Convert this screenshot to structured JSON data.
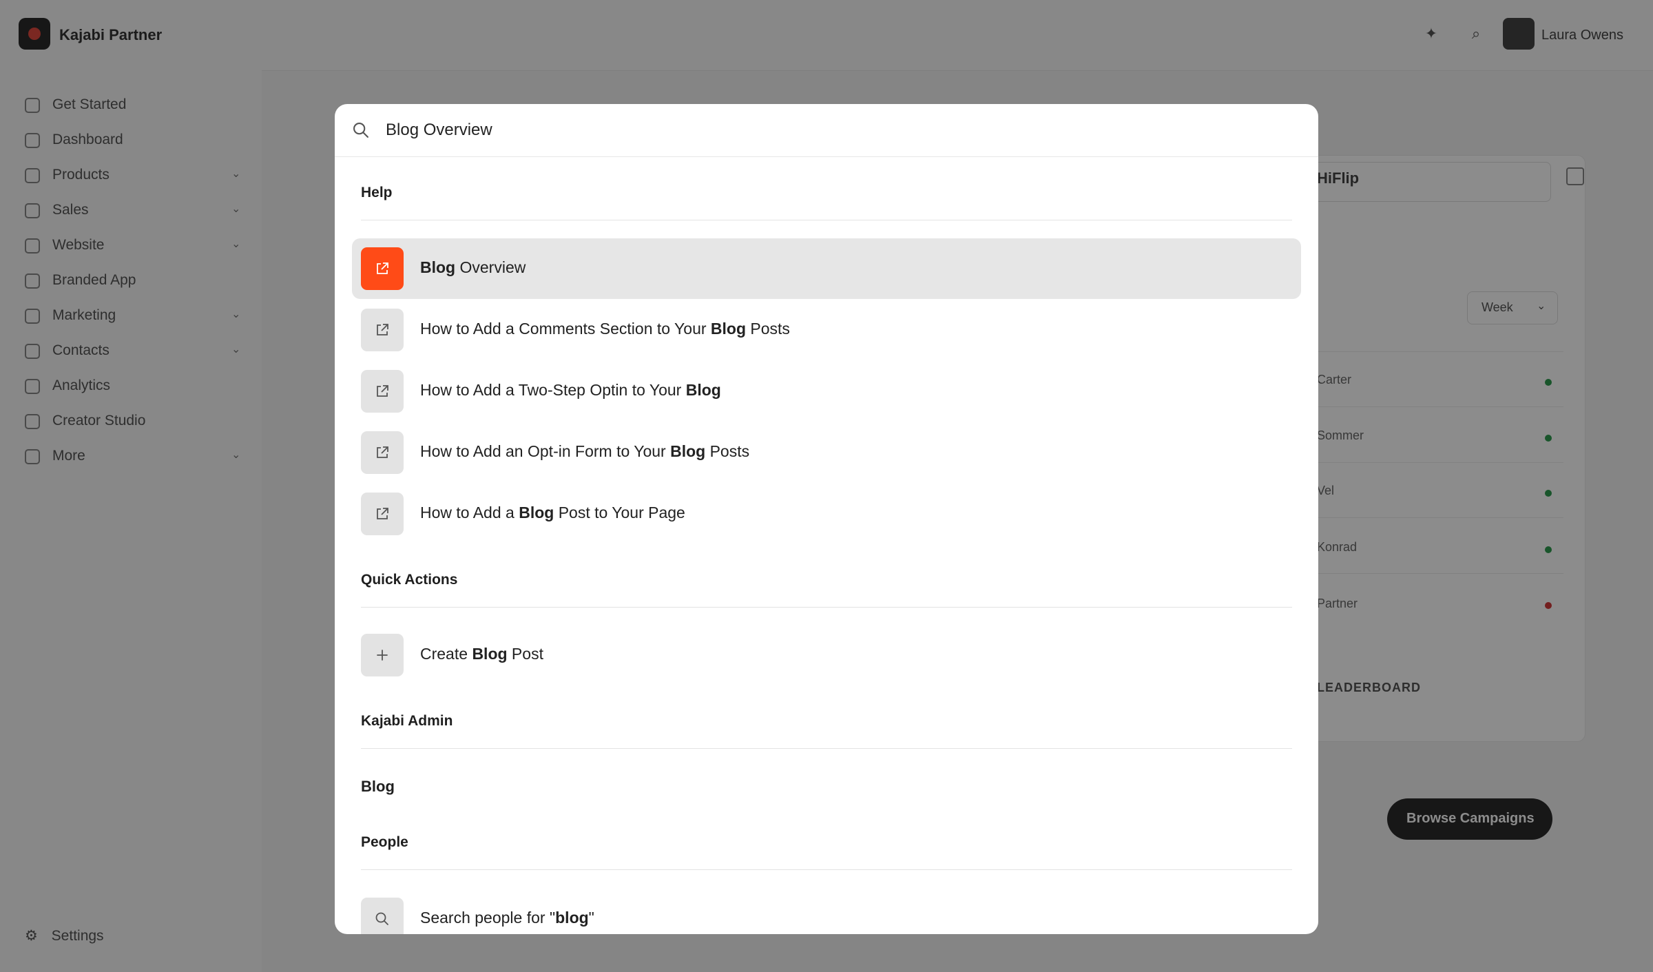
{
  "app": {
    "brand": "Kajabi Partner",
    "user_name": "Laura Owens"
  },
  "sidebar": {
    "items": [
      {
        "label": "Get Started",
        "chevron": false
      },
      {
        "label": "Dashboard",
        "chevron": false
      },
      {
        "label": "Products",
        "chevron": true
      },
      {
        "label": "Sales",
        "chevron": true
      },
      {
        "label": "Website",
        "chevron": true
      },
      {
        "label": "Branded App",
        "chevron": false
      },
      {
        "label": "Marketing",
        "chevron": true
      },
      {
        "label": "Contacts",
        "chevron": true
      },
      {
        "label": "Analytics",
        "chevron": false
      },
      {
        "label": "Creator Studio",
        "chevron": false
      },
      {
        "label": "More",
        "chevron": true
      }
    ],
    "settings": "Settings"
  },
  "background": {
    "input_text": "HiFlip",
    "week_select": "Week",
    "rows": [
      "Carter",
      "Sommer",
      "Vel",
      "Konrad",
      "Partner"
    ],
    "row_dot_colors": [
      "#2e9b4f",
      "#2e9b4f",
      "#2e9b4f",
      "#2e9b4f",
      "#d23a3a"
    ],
    "leaderboard_label": "LEADERBOARD",
    "browse_button": "Browse Campaigns"
  },
  "palette": {
    "search_value": "Blog Overview",
    "sections": {
      "help": "Help",
      "quick_actions": "Quick Actions",
      "kajabi_admin": "Kajabi Admin",
      "people": "People"
    },
    "help_results": [
      {
        "parts": [
          {
            "b": "Blog"
          },
          {
            "t": " Overview"
          }
        ],
        "icon": "external-link-icon"
      },
      {
        "parts": [
          {
            "t": "How to Add a Comments Section to Your "
          },
          {
            "b": "Blog"
          },
          {
            "t": " Posts"
          }
        ],
        "icon": "external-link-icon"
      },
      {
        "parts": [
          {
            "t": "How to Add a Two-Step Optin to Your "
          },
          {
            "b": "Blog"
          }
        ],
        "icon": "external-link-icon"
      },
      {
        "parts": [
          {
            "t": "How to Add an Opt-in Form to Your "
          },
          {
            "b": "Blog"
          },
          {
            "t": " Posts"
          }
        ],
        "icon": "external-link-icon"
      },
      {
        "parts": [
          {
            "t": "How to Add a "
          },
          {
            "b": "Blog"
          },
          {
            "t": " Post to Your Page"
          }
        ],
        "icon": "external-link-icon"
      }
    ],
    "quick_action": {
      "parts": [
        {
          "t": "Create "
        },
        {
          "b": "Blog"
        },
        {
          "t": " Post"
        }
      ],
      "icon": "plus-icon"
    },
    "admin_item": "Blog",
    "people_search": {
      "parts": [
        {
          "t": "Search people for \""
        },
        {
          "b": "blog"
        },
        {
          "t": "\""
        }
      ],
      "icon": "search-icon"
    },
    "accent_color": "#ff4b17"
  }
}
